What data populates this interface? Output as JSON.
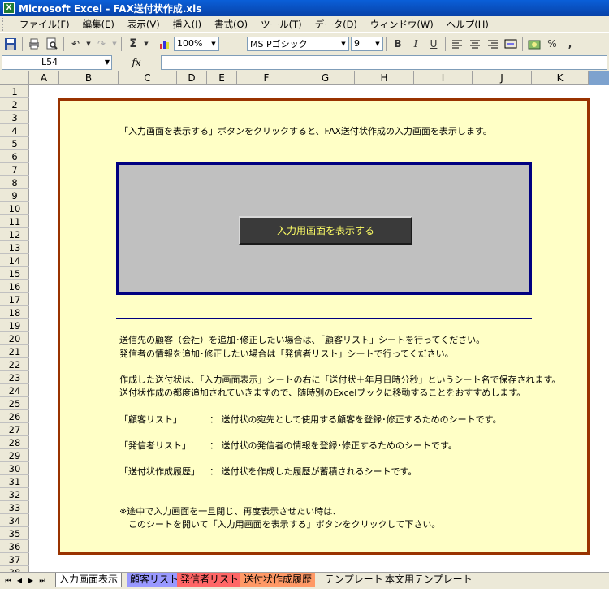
{
  "window": {
    "title": "Microsoft Excel - FAX送付状作成.xls",
    "app_icon_glyph": "X"
  },
  "menu": [
    "ファイル(F)",
    "編集(E)",
    "表示(V)",
    "挿入(I)",
    "書式(O)",
    "ツール(T)",
    "データ(D)",
    "ウィンドウ(W)",
    "ヘルプ(H)"
  ],
  "toolbar": {
    "zoom": "100%",
    "font_name": "MS Pゴシック",
    "font_size": "9",
    "bold": "B",
    "italic": "I",
    "underline": "U",
    "percent": "%",
    "comma": ","
  },
  "formula_bar": {
    "cell_ref": "L54",
    "fx": "fx",
    "value": ""
  },
  "grid": {
    "columns": [
      "A",
      "B",
      "C",
      "D",
      "E",
      "F",
      "G",
      "H",
      "I",
      "J",
      "K"
    ],
    "rows": [
      "1",
      "2",
      "3",
      "4",
      "5",
      "6",
      "7",
      "8",
      "9",
      "10",
      "11",
      "12",
      "13",
      "14",
      "15",
      "16",
      "17",
      "18",
      "19",
      "20",
      "21",
      "22",
      "23",
      "24",
      "25",
      "26",
      "27",
      "28",
      "29",
      "30",
      "31",
      "32",
      "33",
      "34",
      "35",
      "36",
      "37",
      "38"
    ]
  },
  "sheet": {
    "intro": "「入力画面を表示する」ボタンをクリックすると、FAX送付状作成の入力画面を表示します。",
    "show_button": "入力用画面を表示する",
    "line1": "送信先の顧客（会社）を追加･修正したい場合は、「顧客リスト」シートを行ってください。",
    "line2": "発信者の情報を追加･修正したい場合は「発信者リスト」シートで行ってください。",
    "line3": "作成した送付状は、「入力画面表示」シートの右に「送付状＋年月日時分秒」というシート名で保存されます。",
    "line4": "送付状作成の都度追加されていきますので、随時別のExcelブックに移動することをおすすめします。",
    "desc": [
      {
        "label": "「顧客リスト」",
        "text": "：  送付状の宛先として使用する顧客を登録･修正するためのシートです。"
      },
      {
        "label": "「発信者リスト」",
        "text": "：  送付状の発信者の情報を登録･修正するためのシートです。"
      },
      {
        "label": "「送付状作成履歴」",
        "text": "：  送付状を作成した履歴が蓄積されるシートです。"
      }
    ],
    "note1": "※途中で入力画面を一旦閉じ、再度表示させたい時は、",
    "note2": "このシートを開いて「入力用画面を表示する」ボタンをクリックして下さい。"
  },
  "tabs": [
    {
      "label": "入力画面表示",
      "color": "#ffffff"
    },
    {
      "label": "顧客リスト",
      "color": "#9999ff"
    },
    {
      "label": "発信者リスト",
      "color": "#ff6666"
    },
    {
      "label": "送付状作成履歴",
      "color": "#ff9966"
    },
    {
      "label": "テンプレート",
      "color": ""
    },
    {
      "label": "本文用テンプレート",
      "color": ""
    }
  ],
  "colors": {
    "box_bg": "#ffffc6",
    "box_border": "#993300",
    "panel_bg": "#c0c0c0",
    "panel_border": "#000080",
    "button_bg": "#3a3a3a",
    "button_text": "#ffff66"
  }
}
